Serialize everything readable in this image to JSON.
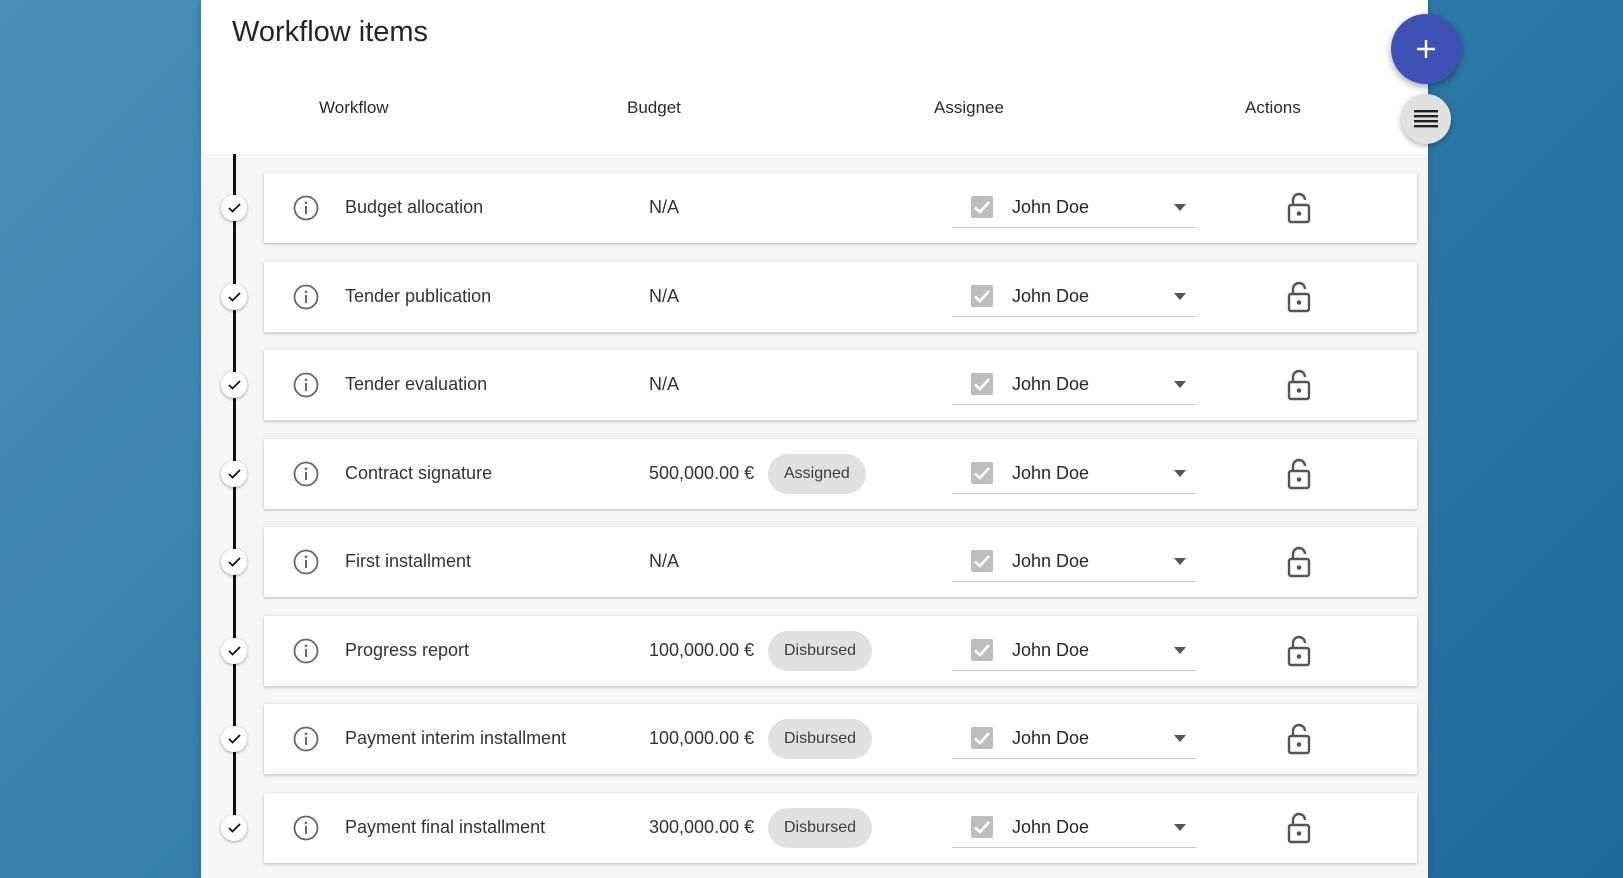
{
  "header": {
    "title": "Workflow items",
    "columns": {
      "workflow": "Workflow",
      "budget": "Budget",
      "assignee": "Assignee",
      "actions": "Actions"
    }
  },
  "fab": {
    "add_icon": "plus-icon",
    "menu_icon": "list-icon",
    "add_color": "#3f51b5"
  },
  "items": [
    {
      "name": "Budget allocation",
      "amount": "N/A",
      "status": "",
      "assignee": "John Doe",
      "done": true
    },
    {
      "name": "Tender publication",
      "amount": "N/A",
      "status": "",
      "assignee": "John Doe",
      "done": true
    },
    {
      "name": "Tender evaluation",
      "amount": "N/A",
      "status": "",
      "assignee": "John Doe",
      "done": true
    },
    {
      "name": "Contract signature",
      "amount": "500,000.00 €",
      "status": "Assigned",
      "assignee": "John Doe",
      "done": true
    },
    {
      "name": "First installment",
      "amount": "N/A",
      "status": "",
      "assignee": "John Doe",
      "done": true
    },
    {
      "name": "Progress report",
      "amount": "100,000.00 €",
      "status": "Disbursed",
      "assignee": "John Doe",
      "done": true
    },
    {
      "name": "Payment interim installment",
      "amount": "100,000.00 €",
      "status": "Disbursed",
      "assignee": "John Doe",
      "done": true
    },
    {
      "name": "Payment final installment",
      "amount": "300,000.00 €",
      "status": "Disbursed",
      "assignee": "John Doe",
      "done": true
    }
  ]
}
